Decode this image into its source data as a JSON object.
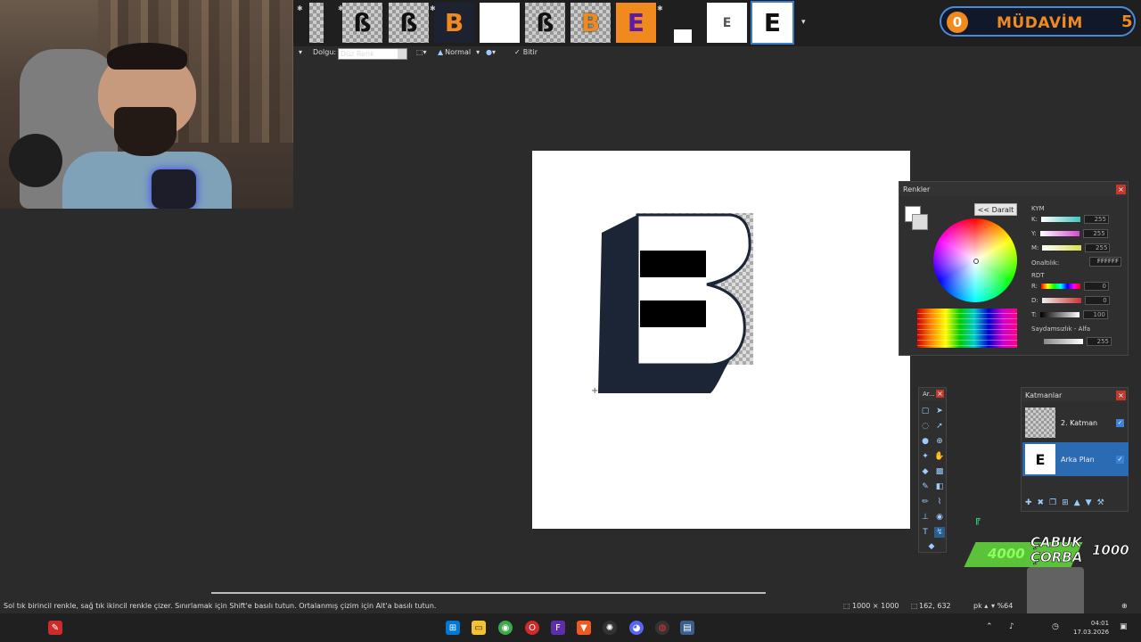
{
  "toolbar": {
    "fill_label": "Dolgu:",
    "fill_value": "Düz Renk",
    "blend_mode": "Normal",
    "finish_label": "Bitir"
  },
  "badge": {
    "count_left": "0",
    "title": "MÜDAVİM",
    "count_right": "5"
  },
  "thumbnails": [
    {
      "glyph": "",
      "kind": "checker"
    },
    {
      "glyph": "ß",
      "kind": "checker"
    },
    {
      "glyph": "ß",
      "kind": "checker"
    },
    {
      "glyph": "B",
      "kind": "dark"
    },
    {
      "glyph": "",
      "kind": "white"
    },
    {
      "glyph": "ß",
      "kind": "checker"
    },
    {
      "glyph": "B",
      "kind": "checker"
    },
    {
      "glyph": "E",
      "kind": "purple"
    },
    {
      "glyph": "",
      "kind": "dark"
    },
    {
      "glyph": "E",
      "kind": "white"
    },
    {
      "glyph": "E",
      "kind": "selected"
    }
  ],
  "colors_panel": {
    "title": "Renkler",
    "less_button": "<< Daralt",
    "cmy_label": "KYM",
    "k_label": "K:",
    "k_value": "255",
    "y_label": "Y:",
    "y_value": "255",
    "m_label": "M:",
    "m_value": "255",
    "hex_label": "Onaltılık:",
    "hex_value": "FFFFFF",
    "rgb_label": "RDT",
    "r_label": "R:",
    "r_value": "0",
    "d_label": "D:",
    "d_value": "0",
    "t_label": "T:",
    "t_value": "100",
    "alpha_label": "Saydamsızlık - Alfa",
    "alpha_value": "255"
  },
  "tools_panel": {
    "title": "Ar..."
  },
  "layers_panel": {
    "title": "Katmanlar",
    "layers": [
      {
        "name": "2. Katman",
        "active": false
      },
      {
        "name": "Arka Plan",
        "active": true
      }
    ]
  },
  "stream_alert": {
    "amount_left": "4000",
    "text": "ÇABUK\nÇORBA",
    "amount_right": "1000"
  },
  "status": {
    "hint": "Sol tık birincil renkle, sağ tık ikincil renkle çizer. Sınırlamak için Shift'e basılı tutun. Ortalanmış çizim için Alt'a basılı tutun.",
    "image_size": "1000 × 1000",
    "cursor_pos": "162, 632",
    "unit": "pk",
    "zoom": "%64"
  },
  "clock": {
    "time": "04:01",
    "date": "17.03.2026"
  },
  "colors": {
    "logo_navy": "#1b2536",
    "accent_blue": "#2a6bb4",
    "badge_orange": "#f08a1e",
    "alert_green": "#5cc23b"
  }
}
